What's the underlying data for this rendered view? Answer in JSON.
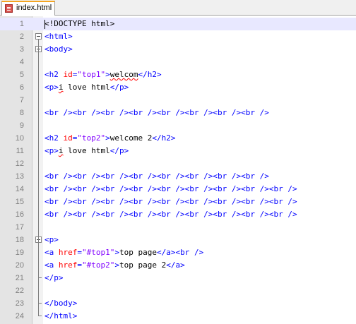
{
  "tab": {
    "label": "index.html",
    "icon": "html-file-icon"
  },
  "colors": {
    "tag": "#0000ff",
    "attr": "#ff0000",
    "value": "#8000ff",
    "current_line": "#e8e8ff"
  },
  "lines": [
    {
      "num": "1",
      "current": true,
      "tokens": [
        {
          "t": "doc",
          "v": "<!DOCTYPE html>"
        }
      ]
    },
    {
      "num": "2",
      "fold": "open",
      "tokens": [
        {
          "t": "tag",
          "v": "<html>"
        }
      ]
    },
    {
      "num": "3",
      "fold": "open",
      "tokens": [
        {
          "t": "tag",
          "v": "<body>"
        }
      ]
    },
    {
      "num": "4",
      "tokens": []
    },
    {
      "num": "5",
      "tokens": [
        {
          "t": "tag",
          "v": "<h2 "
        },
        {
          "t": "attr",
          "v": "id"
        },
        {
          "t": "tag",
          "v": "="
        },
        {
          "t": "val",
          "v": "\"top1\""
        },
        {
          "t": "tag",
          "v": ">"
        },
        {
          "t": "spell",
          "v": "welcom"
        },
        {
          "t": "tag",
          "v": "</h2>"
        }
      ]
    },
    {
      "num": "6",
      "tokens": [
        {
          "t": "tag",
          "v": "<p>"
        },
        {
          "t": "spell",
          "v": "i"
        },
        {
          "t": "text",
          "v": " love html"
        },
        {
          "t": "tag",
          "v": "</p>"
        }
      ]
    },
    {
      "num": "7",
      "tokens": []
    },
    {
      "num": "8",
      "tokens": [
        {
          "t": "tag",
          "v": "<br /><br /><br /><br /><br /><br /><br /><br />"
        }
      ]
    },
    {
      "num": "9",
      "tokens": []
    },
    {
      "num": "10",
      "tokens": [
        {
          "t": "tag",
          "v": "<h2 "
        },
        {
          "t": "attr",
          "v": "id"
        },
        {
          "t": "tag",
          "v": "="
        },
        {
          "t": "val",
          "v": "\"top2\""
        },
        {
          "t": "tag",
          "v": ">"
        },
        {
          "t": "text",
          "v": "welcome 2"
        },
        {
          "t": "tag",
          "v": "</h2>"
        }
      ]
    },
    {
      "num": "11",
      "tokens": [
        {
          "t": "tag",
          "v": "<p>"
        },
        {
          "t": "spell",
          "v": "i"
        },
        {
          "t": "text",
          "v": " love html"
        },
        {
          "t": "tag",
          "v": "</p>"
        }
      ]
    },
    {
      "num": "12",
      "tokens": []
    },
    {
      "num": "13",
      "tokens": [
        {
          "t": "tag",
          "v": "<br /><br /><br /><br /><br /><br /><br /><br />"
        }
      ]
    },
    {
      "num": "14",
      "tokens": [
        {
          "t": "tag",
          "v": "<br /><br /><br /><br /><br /><br /><br /><br /><br />"
        }
      ]
    },
    {
      "num": "15",
      "tokens": [
        {
          "t": "tag",
          "v": "<br /><br /><br /><br /><br /><br /><br /><br /><br />"
        }
      ]
    },
    {
      "num": "16",
      "tokens": [
        {
          "t": "tag",
          "v": "<br /><br /><br /><br /><br /><br /><br /><br /><br />"
        }
      ]
    },
    {
      "num": "17",
      "tokens": []
    },
    {
      "num": "18",
      "fold": "open",
      "tokens": [
        {
          "t": "tag",
          "v": "<p>"
        }
      ]
    },
    {
      "num": "19",
      "tokens": [
        {
          "t": "tag",
          "v": "<a "
        },
        {
          "t": "attr",
          "v": "href"
        },
        {
          "t": "tag",
          "v": "="
        },
        {
          "t": "val",
          "v": "\"#top1\""
        },
        {
          "t": "tag",
          "v": ">"
        },
        {
          "t": "text",
          "v": "top page"
        },
        {
          "t": "tag",
          "v": "</a><br />"
        }
      ]
    },
    {
      "num": "20",
      "tokens": [
        {
          "t": "tag",
          "v": "<a "
        },
        {
          "t": "attr",
          "v": "href"
        },
        {
          "t": "tag",
          "v": "="
        },
        {
          "t": "val",
          "v": "\"#top2\""
        },
        {
          "t": "tag",
          "v": ">"
        },
        {
          "t": "text",
          "v": "top page 2"
        },
        {
          "t": "tag",
          "v": "</a>"
        }
      ]
    },
    {
      "num": "21",
      "fold": "end",
      "tokens": [
        {
          "t": "tag",
          "v": "</p>"
        }
      ]
    },
    {
      "num": "22",
      "tokens": []
    },
    {
      "num": "23",
      "fold": "end",
      "tokens": [
        {
          "t": "tag",
          "v": "</body>"
        }
      ]
    },
    {
      "num": "24",
      "fold": "end",
      "tokens": [
        {
          "t": "tag",
          "v": "</html>"
        }
      ]
    }
  ]
}
